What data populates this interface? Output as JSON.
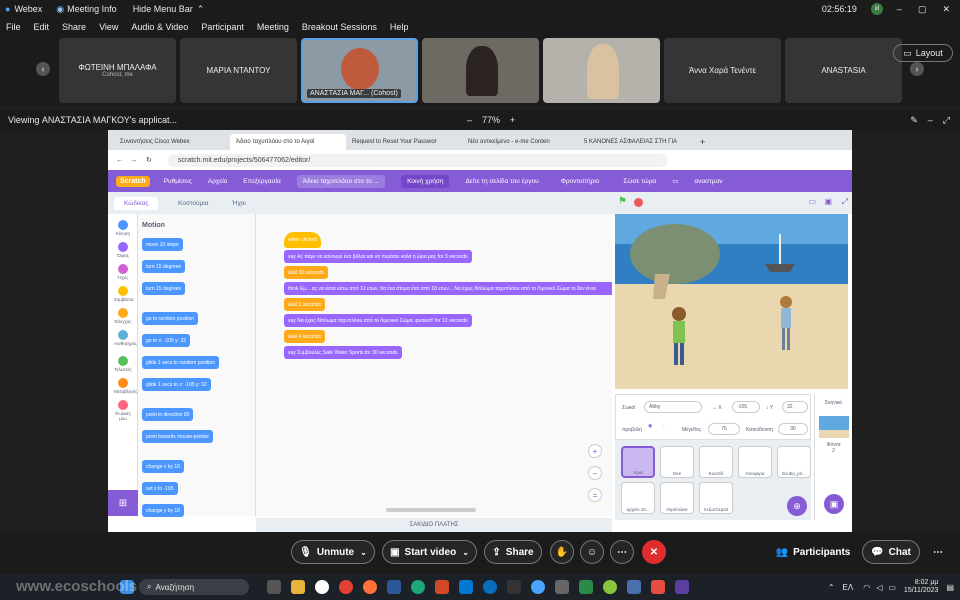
{
  "titlebar": {
    "app_name": "Webex",
    "meeting_info": "Meeting Info",
    "hide_menu": "Hide Menu Bar",
    "time": "02:56:19",
    "badge": "id"
  },
  "menu": [
    "File",
    "Edit",
    "Share",
    "View",
    "Audio & Video",
    "Participant",
    "Meeting",
    "Breakout Sessions",
    "Help"
  ],
  "participants": [
    {
      "name": "ΦΩΤΕΙΝΗ ΜΠΑΛΑΦΑ",
      "sub": "Cohost, me",
      "video": false
    },
    {
      "name": "ΜΑΡΙΑ ΝΤΑΝΤΟΥ",
      "sub": "",
      "video": false
    },
    {
      "name": "ΑΝΑΣΤΑΣΙΑ ΜΑΓ... (Cohost)",
      "sub": "",
      "video": true
    },
    {
      "name": "",
      "sub": "",
      "video": true
    },
    {
      "name": "",
      "sub": "",
      "video": true
    },
    {
      "name": "Άννα Χαρά Τενέντε",
      "sub": "",
      "video": false
    },
    {
      "name": "ANASTASIA",
      "sub": "",
      "video": false
    }
  ],
  "layout_label": "Layout",
  "viewing": {
    "text": "Viewing ΑΝΑΣΤΑΣΙΑ ΜΑΓΚΟΥ's applicat...",
    "zoom": "77%"
  },
  "browser": {
    "tabs": [
      "Συναντήσεις Cisco Webex",
      "Άδειο ταχυπλόου στο το Αιγαί",
      "Request to Reset Your Passwor",
      "Νέο αντικείμενο - e-me Conten",
      "5 ΚΑΝΟΝΕΣ ΑΣΦΑΛΕΙΑΣ ΣΤΗ ΓΙΑ"
    ],
    "url": "scratch.mit.edu/projects/506477062/editor/"
  },
  "scratch": {
    "menu": [
      "Ρυθμίσεις",
      "Αρχείο",
      "Επεξεργασία"
    ],
    "project_title": "Άδειο ταχυπλόου στο το ...",
    "share": "Κοινή χρήση",
    "see_project": "Δείτε τη σελίδα του έργου",
    "tutorials": "Φροντιστήριο",
    "save_now": "Σώσε τώρα",
    "user": "αναστμαν",
    "tabs": [
      "Κώδικας",
      "Κοστούμια",
      "Ήχοι"
    ],
    "categories": [
      "Κίνηση",
      "Όψεις",
      "Ήχος",
      "Συμβάντα",
      "Έλεγχος",
      "Αισθητήρες",
      "Τελεστές",
      "Μεταβλητές",
      "Οι Δικές μου"
    ],
    "palette_title": "Motion",
    "palette_blocks": [
      "move 10 steps",
      "turn 15 degrees",
      "turn 15 degrees",
      "go to random position",
      "go to x: -105 y: 32",
      "glide 1 secs to random position",
      "glide 1 secs to x: -105 y: 32",
      "point in direction 90",
      "point towards mouse-pointer",
      "change x by 10",
      "set x to -105",
      "change y by 10"
    ],
    "script": [
      "when clicked",
      "say Ας πάμε να κανουμε ένα βόλτα και να περάσει καλά η ώρα μας for 3 seconds",
      "wait 30 seconds",
      "think Εμ... ας να είσαι κάτω από 12 ετών, θα ένα άτομα έτσι από 18 ετών... Να έχεις δίπλωμα ταχυπλόου από το Λιμενικό Σώμα το δεν είναι",
      "wait 1 seconds",
      "say Να έχεις δίπλωμα ταχυπλόου από το Λιμενικό Σώμα, φυσικά!! for 12 seconds",
      "wait 4 seconds",
      "say Συμβουλές Safe Water Sports for 30 seconds"
    ],
    "sprite_label": "Σωκοί",
    "sprite_name": "Abby",
    "x": "-105",
    "y": "32",
    "show": "προβολή",
    "size_label": "Μέγεθος",
    "size": "75",
    "direction_label": "Κατεύθυνση",
    "direction": "90",
    "sprites": [
      "Λρια",
      "Dee",
      "Koorzili",
      "Λιτοφαρα",
      "Scuba_pri...",
      "αρχείο 10...",
      "imprimiare",
      "πεζωπτερα2"
    ],
    "stage_label": "Σκηνικό",
    "backdrops_label": "Φόντα",
    "backdrops_count": "2",
    "footer": "ΣΑΚΙΔΙΟ ΠΛΑΤΗΣ"
  },
  "controls": {
    "unmute": "Unmute",
    "start_video": "Start video",
    "share": "Share",
    "participants": "Participants",
    "chat": "Chat"
  },
  "taskbar": {
    "search": "Αναζήτηση",
    "lang": "ΕΛ",
    "time": "8:02 μμ",
    "date": "15/11/2023",
    "watermark": "www.ecoschools"
  }
}
